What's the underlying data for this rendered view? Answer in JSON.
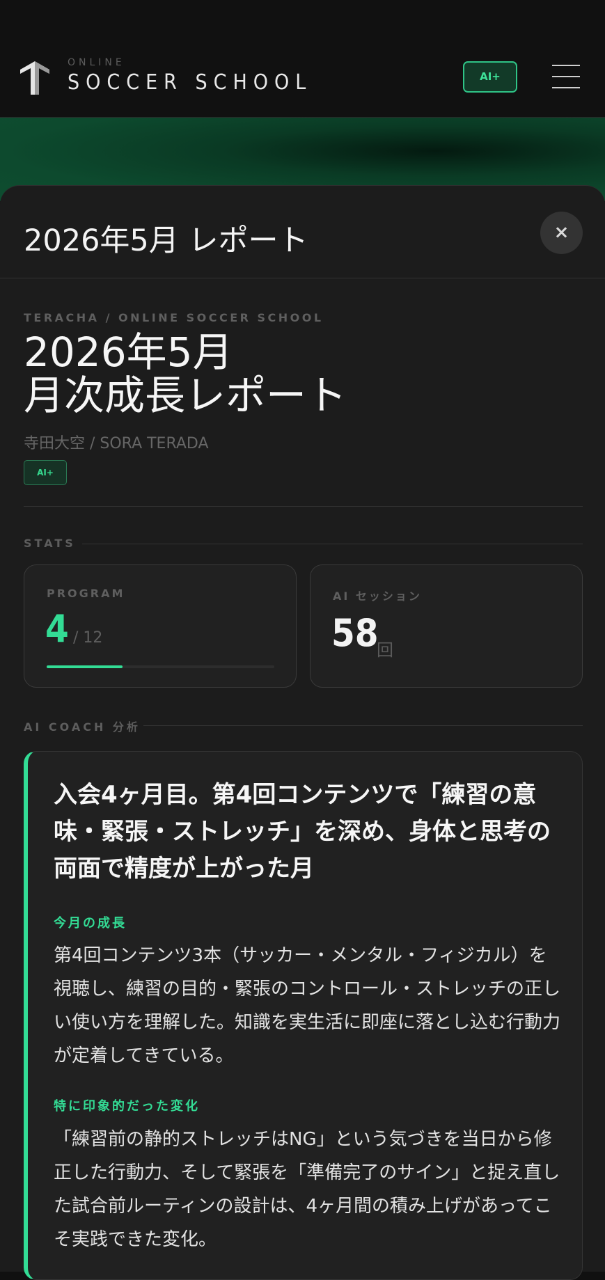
{
  "header": {
    "logo_small": "ONLINE",
    "logo_main": "SOCCER SCHOOL",
    "ai_badge": "AI+"
  },
  "sheet": {
    "title": "2026年5月 レポート",
    "close_icon": "×"
  },
  "report": {
    "brand_line": "TERACHA / ONLINE SOCCER SCHOOL",
    "title_line1": "2026年5月",
    "title_line2": "月次成長レポート",
    "student_name": "寺田大空 / SORA TERADA",
    "badge": "AI+"
  },
  "stats": {
    "section_label": "STATS",
    "program": {
      "label": "PROGRAM",
      "value": "4",
      "total": "/ 12",
      "progress_fraction": 0.333
    },
    "ai_session": {
      "label": "AI セッション",
      "value": "58",
      "unit": "回"
    }
  },
  "coach": {
    "section_label": "AI COACH 分析",
    "headline": "入会4ヶ月目。第4回コンテンツで「練習の意味・緊張・ストレッチ」を深め、身体と思考の両面で精度が上がった月",
    "growth_label": "今月の成長",
    "growth_text": "第4回コンテンツ3本（サッカー・メンタル・フィジカル）を視聴し、練習の目的・緊張のコントロール・ストレッチの正しい使い方を理解した。知識を実生活に即座に落とし込む行動力が定着してきている。",
    "change_label": "特に印象的だった変化",
    "change_text": "「練習前の静的ストレッチはNG」という気づきを当日から修正した行動力、そして緊張を「準備完了のサイン」と捉え直した試合前ルーティンの設計は、4ヶ月間の積み上げがあってこそ実践できた変化。"
  },
  "colors": {
    "accent": "#33dc95",
    "background": "#101010",
    "card": "#212121"
  }
}
